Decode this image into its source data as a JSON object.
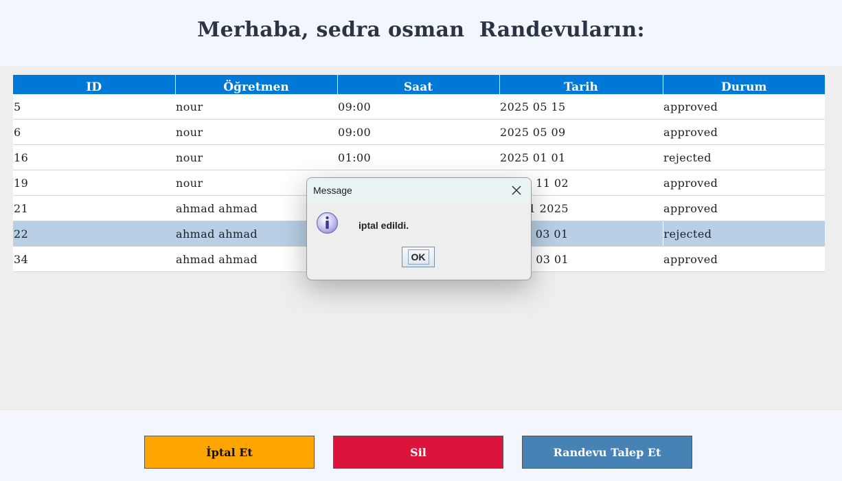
{
  "header": {
    "title": "Merhaba, sedra osman  Randevuların:"
  },
  "table": {
    "columns": [
      "ID",
      "Öğretmen",
      "Saat",
      "Tarih",
      "Durum"
    ],
    "rows": [
      {
        "id": "5",
        "teacher": "nour",
        "time": "09:00",
        "date": "2025 05 15",
        "status": "approved"
      },
      {
        "id": "6",
        "teacher": "nour",
        "time": "09:00",
        "date": "2025 05 09",
        "status": "approved"
      },
      {
        "id": "16",
        "teacher": "nour",
        "time": "01:00",
        "date": "2025 01 01",
        "status": "rejected"
      },
      {
        "id": "19",
        "teacher": "nour",
        "time": "",
        "date": " 11 02",
        "status": "approved"
      },
      {
        "id": "21",
        "teacher": "ahmad ahmad",
        "time": "",
        "date": "1 2025",
        "status": "approved"
      },
      {
        "id": "22",
        "teacher": "ahmad ahmad",
        "time": "",
        "date": " 03 01",
        "status": "rejected"
      },
      {
        "id": "34",
        "teacher": "ahmad ahmad",
        "time": "",
        "date": " 03 01",
        "status": "approved"
      }
    ],
    "selected_row_id": "22"
  },
  "buttons": {
    "cancel_label": "İptal Et",
    "delete_label": "Sil",
    "request_label": "Randevu Talep Et"
  },
  "dialog": {
    "title": "Message",
    "message": "iptal edildi.",
    "ok_label": "OK"
  },
  "colors": {
    "header_bg": "#0078d7",
    "selected_row": "#b8cfe5",
    "cancel": "#ffa500",
    "delete": "#dc143c",
    "request": "#4682b4"
  }
}
